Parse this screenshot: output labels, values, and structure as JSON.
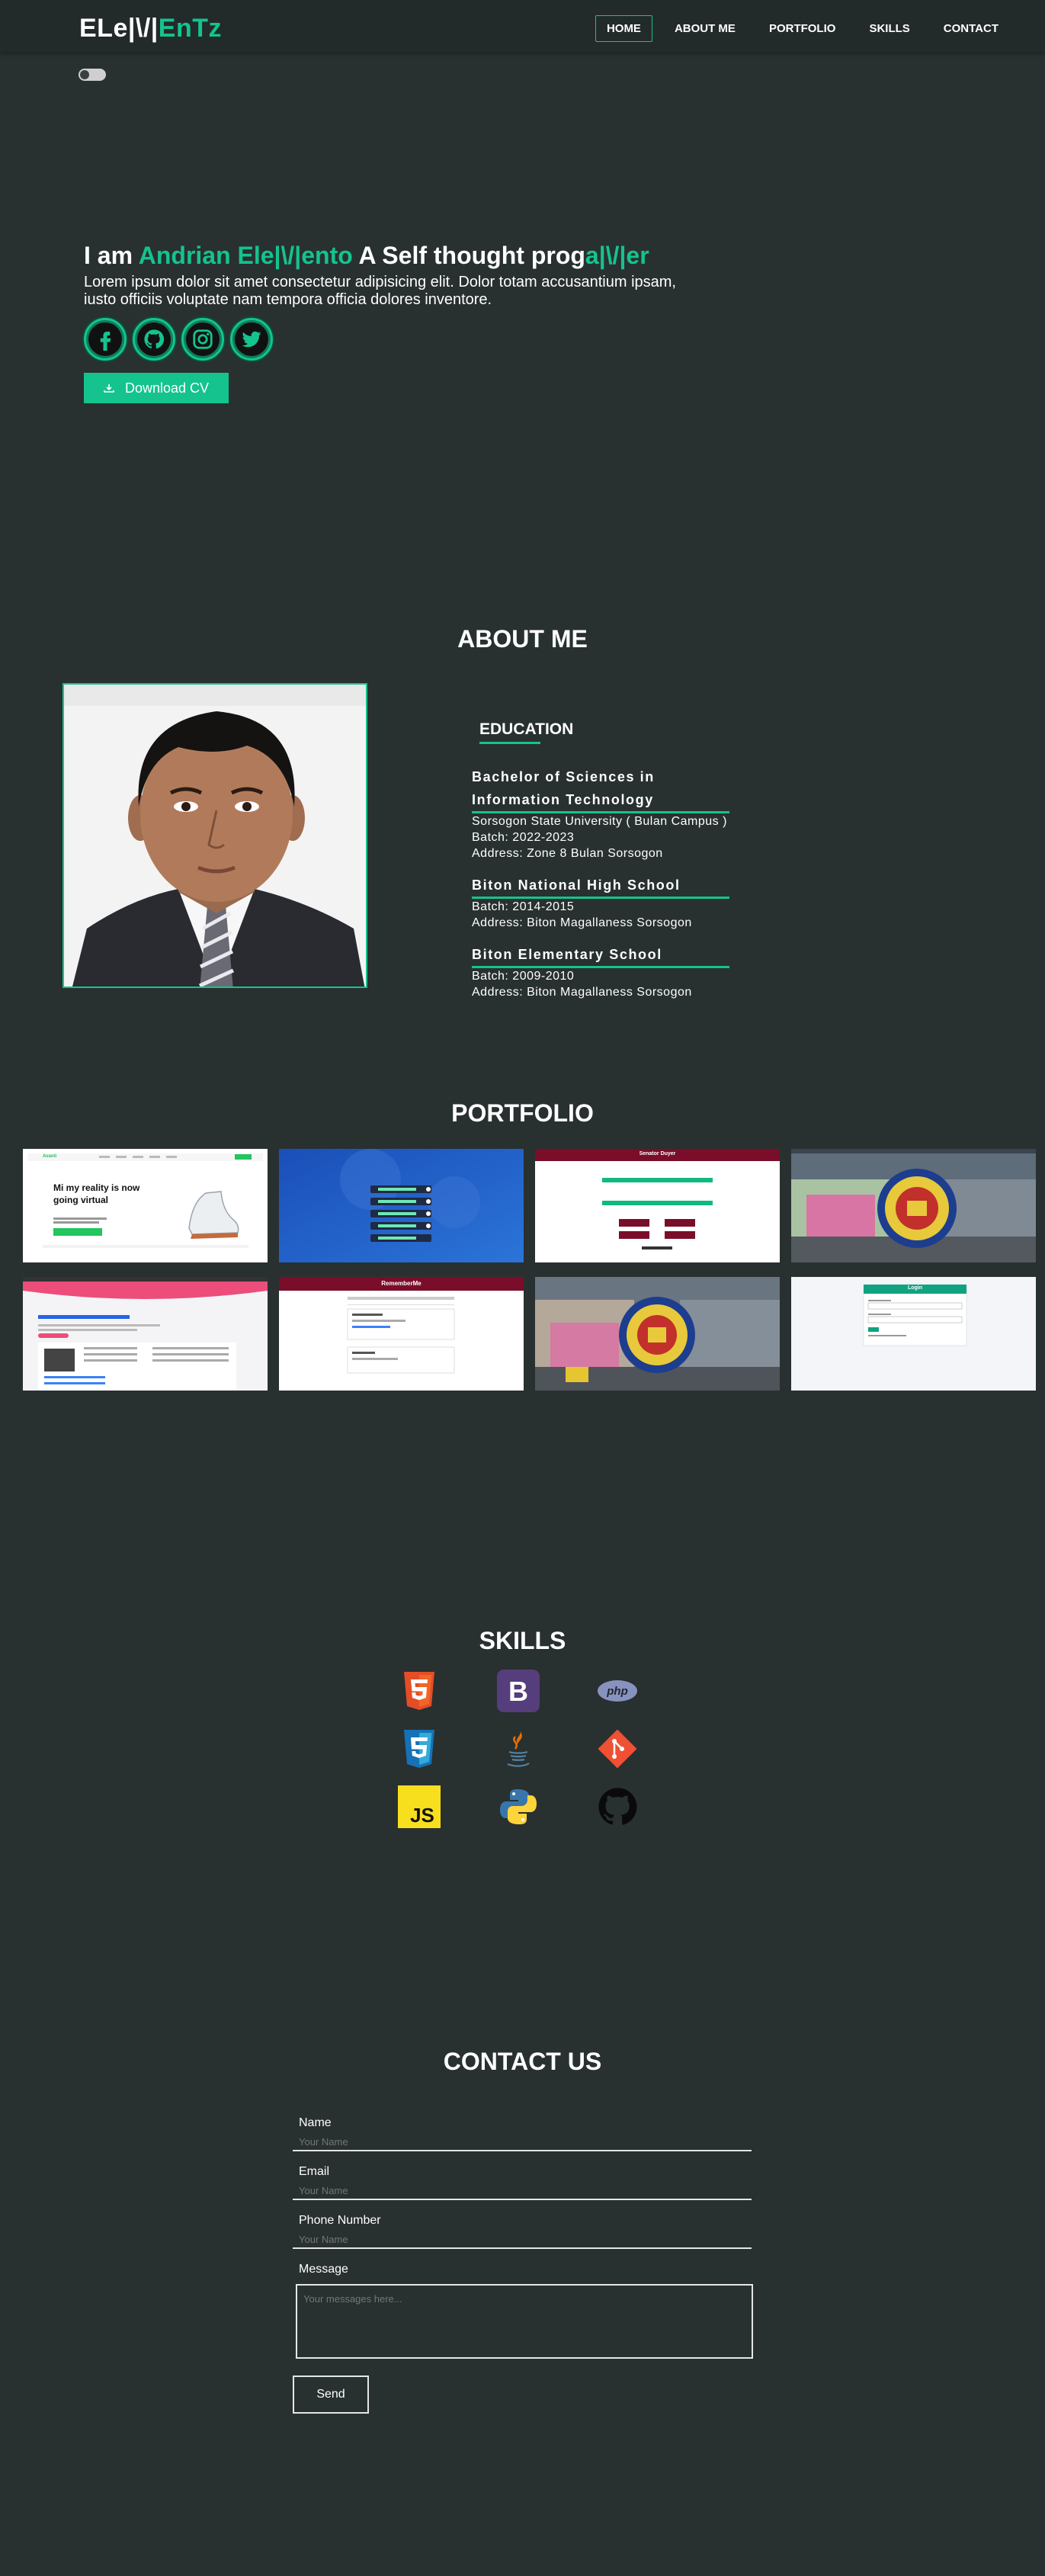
{
  "brand": {
    "part1": "ELe|\\/|",
    "part2": "EnTz"
  },
  "nav": {
    "items": [
      {
        "label": "HOME",
        "active": true
      },
      {
        "label": "ABOUT ME"
      },
      {
        "label": "PORTFOLIO"
      },
      {
        "label": "SKILLS"
      },
      {
        "label": "CONTACT"
      }
    ]
  },
  "hero": {
    "prefix": "I am ",
    "name": "Andrian Ele|\\/|ento",
    "middle": " A Self thought prog",
    "suffix_accent": "a|\\/|er",
    "description": "Lorem ipsum dolor sit amet consectetur adipisicing elit. Dolor totam accusantium ipsam, iusto officiis voluptate nam tempora officia dolores inventore.",
    "socials": [
      "facebook-icon",
      "github-icon",
      "instagram-icon",
      "twitter-icon"
    ],
    "download_label": "Download CV"
  },
  "about": {
    "title": "ABOUT ME",
    "education_heading": "EDUCATION",
    "schools": [
      {
        "name": "Bachelor of Sciences in Information Technology",
        "lines": [
          "Sorsogon State University ( Bulan Campus )",
          "Batch: 2022-2023",
          "Address: Zone 8 Bulan Sorsogon"
        ]
      },
      {
        "name": "Biton National High School",
        "lines": [
          "Batch: 2014-2015",
          "Address: Biton Magallaness Sorsogon"
        ]
      },
      {
        "name": "Biton Elementary School",
        "lines": [
          "Batch: 2009-2010",
          "Address: Biton Magallaness Sorsogon"
        ]
      }
    ]
  },
  "portfolio": {
    "title": "PORTFOLIO",
    "thumb_texts": {
      "shoe_logo": "Avanti",
      "shoe_headline_1": "Mi my reality is now",
      "shoe_headline_2": "going virtual",
      "voter_title": "Senator Duyer",
      "remember_title": "RememberMe",
      "login_title": "Login"
    }
  },
  "skills": {
    "title": "SKILLS",
    "items": [
      "html5-icon",
      "bootstrap-icon",
      "php-icon",
      "css3-icon",
      "java-icon",
      "git-icon",
      "javascript-icon",
      "python-icon",
      "github-icon"
    ],
    "labels": {
      "bootstrap": "B",
      "php": "php",
      "javascript": "JS"
    }
  },
  "contact": {
    "title": "CONTACT US",
    "fields": [
      {
        "label": "Name",
        "placeholder": "Your Name"
      },
      {
        "label": "Email",
        "placeholder": "Your Name"
      },
      {
        "label": "Phone Number",
        "placeholder": "Your Name"
      }
    ],
    "message_label": "Message",
    "message_placeholder": "Your messages here...",
    "send_label": "Send"
  },
  "colors": {
    "accent": "#14c38e",
    "background": "#293030",
    "navbar": "#232a2a"
  }
}
